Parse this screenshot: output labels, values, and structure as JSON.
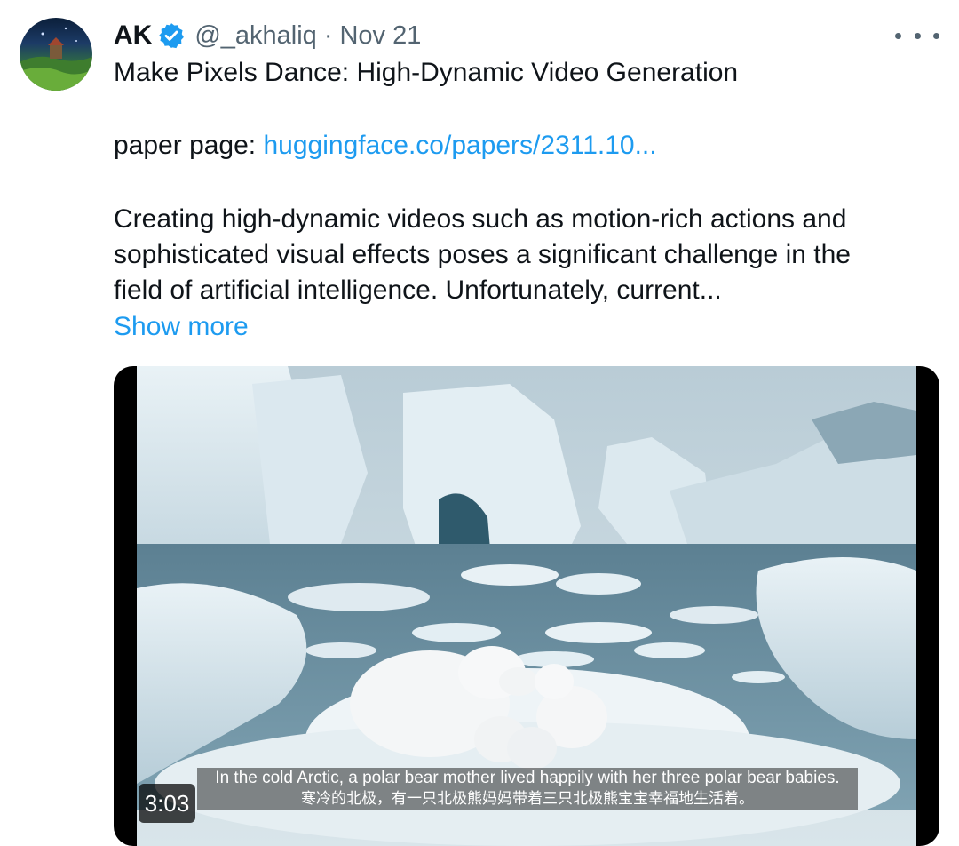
{
  "tweet": {
    "display_name": "AK",
    "handle": "@_akhaliq",
    "separator": "·",
    "date": "Nov 21",
    "title": "Make Pixels Dance: High-Dynamic Video Generation",
    "paper_prefix": "paper page: ",
    "paper_link": "huggingface.co/papers/2311.10...",
    "body_line1": "Creating high-dynamic videos such as motion-rich actions and",
    "body_line2": "sophisticated visual effects poses a significant challenge in the",
    "body_line3": "field of artificial intelligence. Unfortunately, current...",
    "show_more": "Show more"
  },
  "video": {
    "duration": "3:03",
    "subtitle_en": "In the cold Arctic, a polar bear mother lived happily with her three polar bear babies.",
    "subtitle_zh": "寒冷的北极，有一只北极熊妈妈带着三只北极熊宝宝幸福地生活着。"
  },
  "icons": {
    "verified": "verified-badge-icon",
    "more": "more-options-icon"
  },
  "colors": {
    "link": "#1d9bf0",
    "secondary_text": "#536471",
    "verified": "#1d9bf0"
  }
}
